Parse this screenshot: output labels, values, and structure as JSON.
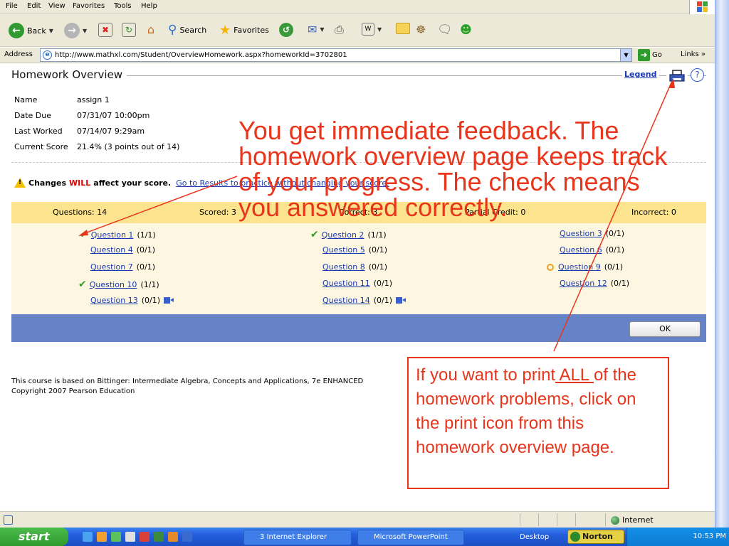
{
  "browser": {
    "menu": [
      "File",
      "Edit",
      "View",
      "Favorites",
      "Tools",
      "Help"
    ],
    "toolbar": {
      "back": "Back",
      "search": "Search",
      "favorites": "Favorites"
    },
    "address": {
      "label": "Address",
      "url": "http://www.mathxl.com/Student/OverviewHomework.aspx?homeworkId=3702801",
      "go": "Go",
      "links": "Links"
    },
    "status": {
      "zone": "Internet"
    }
  },
  "page": {
    "title": "Homework Overview",
    "legend": "Legend",
    "help": "?",
    "info": [
      {
        "key": "Name",
        "value": "assign 1"
      },
      {
        "key": "Date Due",
        "value": "07/31/07 10:00pm"
      },
      {
        "key": "Last Worked",
        "value": "07/14/07 9:29am"
      },
      {
        "key": "Current Score",
        "value": "21.4% (3 points out of 14)"
      }
    ],
    "warning": {
      "prefix": "Changes",
      "emphasis": "WILL",
      "suffix": "affect your score.",
      "link": "Go to Results to practice without changing your score."
    },
    "summary": {
      "questions": "Questions: 14",
      "scored": "Scored: 3",
      "correct": "Correct: 3",
      "partial": "Partial Credit: 0",
      "incorrect": "Incorrect: 0"
    },
    "questions": [
      {
        "label": "Question 1",
        "score": "(1/1)",
        "status": "correct"
      },
      {
        "label": "Question 2",
        "score": "(1/1)",
        "status": "correct"
      },
      {
        "label": "Question 3",
        "score": "(0/1)",
        "status": "none"
      },
      {
        "label": "Question 4",
        "score": "(0/1)",
        "status": "none"
      },
      {
        "label": "Question 5",
        "score": "(0/1)",
        "status": "none"
      },
      {
        "label": "Question 6",
        "score": "(0/1)",
        "status": "none"
      },
      {
        "label": "Question 7",
        "score": "(0/1)",
        "status": "none"
      },
      {
        "label": "Question 8",
        "score": "(0/1)",
        "status": "none"
      },
      {
        "label": "Question 9",
        "score": "(0/1)",
        "status": "partial"
      },
      {
        "label": "Question 10",
        "score": "(1/1)",
        "status": "correct"
      },
      {
        "label": "Question 11",
        "score": "(0/1)",
        "status": "none"
      },
      {
        "label": "Question 12",
        "score": "(0/1)",
        "status": "none"
      },
      {
        "label": "Question 13",
        "score": "(0/1)",
        "status": "video"
      },
      {
        "label": "Question 14",
        "score": "(0/1)",
        "status": "video"
      }
    ],
    "ok_button": "OK",
    "course_line1": "This course is based on Bittinger: Intermediate Algebra, Concepts and Applications, 7e ENHANCED",
    "course_line2": "Copyright 2007 Pearson Education"
  },
  "taskbar": {
    "start": "start",
    "items": [
      "3 Internet Explorer",
      "Microsoft PowerPoint"
    ],
    "desktop": "Desktop",
    "norton": "Norton",
    "clock": "10:53 PM"
  },
  "annotations": {
    "main": "You get immediate feedback.  The homework overview page keeps track of your progress.  The check means you answered correctly.",
    "callout_before": "If you want to print",
    "callout_underlined": " ALL ",
    "callout_after": "of the homework problems, click on the print icon from this homework overview page."
  },
  "colors": {
    "annotation": "#e8351c",
    "summary_bar": "#fce48f",
    "grid_bg": "#fdf7e1",
    "action_bar": "#6583c6",
    "link": "#1a39b2",
    "check": "#3a9a2a"
  }
}
